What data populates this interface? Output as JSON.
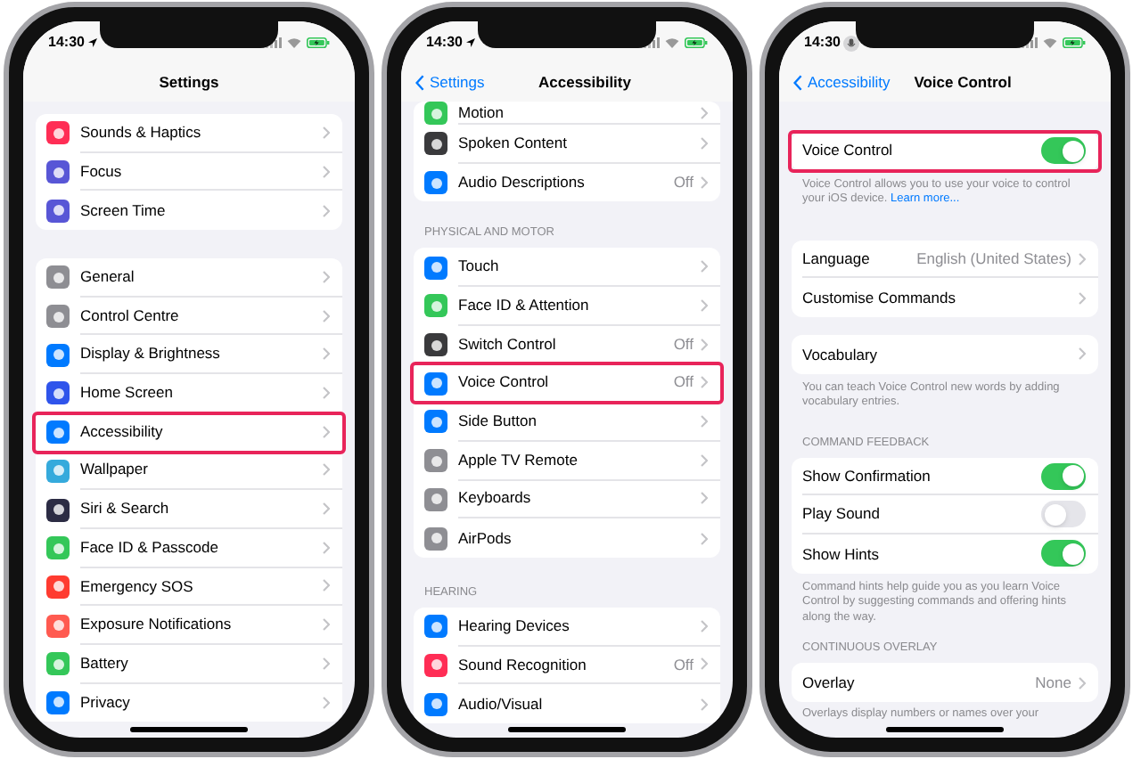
{
  "phones": [
    {
      "time": "14:30",
      "kind": "location",
      "nav": {
        "title": "Settings"
      },
      "sections": [
        {
          "items": [
            {
              "label": "Sounds & Haptics",
              "kind": "link",
              "color": "#ff2d55",
              "highlighted": false
            },
            {
              "label": "Focus",
              "kind": "link",
              "color": "#5856d6",
              "highlighted": false
            },
            {
              "label": "Screen Time",
              "kind": "link",
              "color": "#5856d6",
              "highlighted": false
            }
          ]
        },
        {
          "items": [
            {
              "label": "General",
              "kind": "link",
              "color": "#8e8e93",
              "highlighted": false
            },
            {
              "label": "Control Centre",
              "kind": "link",
              "color": "#8e8e93",
              "highlighted": false
            },
            {
              "label": "Display & Brightness",
              "kind": "link",
              "color": "#007aff",
              "highlighted": false
            },
            {
              "label": "Home Screen",
              "kind": "link",
              "color": "#2f54eb",
              "highlighted": false
            },
            {
              "label": "Accessibility",
              "kind": "link",
              "color": "#007aff",
              "highlighted": true
            },
            {
              "label": "Wallpaper",
              "kind": "link",
              "color": "#35aadc",
              "highlighted": false
            },
            {
              "label": "Siri & Search",
              "kind": "link",
              "color": "#2c2c44",
              "highlighted": false
            },
            {
              "label": "Face ID & Passcode",
              "kind": "link",
              "color": "#34c759",
              "highlighted": false
            },
            {
              "label": "Emergency SOS",
              "kind": "link",
              "color": "#ff3b30",
              "highlighted": false
            },
            {
              "label": "Exposure Notifications",
              "kind": "link",
              "color": "#ff5a50",
              "highlighted": false
            },
            {
              "label": "Battery",
              "kind": "link",
              "color": "#34c759",
              "highlighted": false
            },
            {
              "label": "Privacy",
              "kind": "link",
              "color": "#007aff",
              "highlighted": false
            }
          ]
        }
      ]
    },
    {
      "time": "14:30",
      "kind": "location",
      "nav": {
        "back": "Settings",
        "title": "Accessibility"
      },
      "sections": [
        {
          "items": [
            {
              "label": "Motion",
              "kind": "link",
              "color": "#34c759",
              "highlighted": false
            },
            {
              "label": "Spoken Content",
              "kind": "link",
              "color": "#3a3a3c",
              "highlighted": false
            },
            {
              "label": "Audio Descriptions",
              "value": "Off",
              "kind": "link",
              "color": "#007aff",
              "highlighted": false
            }
          ]
        },
        {
          "header": "PHYSICAL AND MOTOR",
          "items": [
            {
              "label": "Touch",
              "kind": "link",
              "color": "#007aff",
              "highlighted": false
            },
            {
              "label": "Face ID & Attention",
              "kind": "link",
              "color": "#34c759",
              "highlighted": false
            },
            {
              "label": "Switch Control",
              "value": "Off",
              "kind": "link",
              "color": "#3a3a3c",
              "highlighted": false
            },
            {
              "label": "Voice Control",
              "value": "Off",
              "kind": "link",
              "color": "#007aff",
              "highlighted": true
            },
            {
              "label": "Side Button",
              "kind": "link",
              "color": "#007aff",
              "highlighted": false
            },
            {
              "label": "Apple TV Remote",
              "kind": "link",
              "color": "#8e8e93",
              "highlighted": false
            },
            {
              "label": "Keyboards",
              "kind": "link",
              "color": "#8e8e93",
              "highlighted": false
            },
            {
              "label": "AirPods",
              "kind": "link",
              "color": "#8e8e93",
              "highlighted": false
            }
          ]
        },
        {
          "header": "HEARING",
          "items": [
            {
              "label": "Hearing Devices",
              "kind": "link",
              "color": "#007aff",
              "highlighted": false
            },
            {
              "label": "Sound Recognition",
              "value": "Off",
              "kind": "link",
              "color": "#ff2d55",
              "highlighted": false
            },
            {
              "label": "Audio/Visual",
              "kind": "link",
              "color": "#007aff",
              "highlighted": false
            }
          ]
        }
      ]
    },
    {
      "time": "14:30",
      "kind": "mic",
      "nav": {
        "back": "Accessibility",
        "title": "Voice Control"
      },
      "sections": [
        {
          "items": [
            {
              "label": "Voice Control",
              "kind": "toggle",
              "on": true,
              "highlighted": true
            }
          ],
          "footer": "Voice Control allows you to use your voice to control your iOS device.",
          "footer_link": "Learn more..."
        },
        {
          "items": [
            {
              "label": "Language",
              "value": "English (United States)",
              "kind": "link",
              "highlighted": false
            },
            {
              "label": "Customise Commands",
              "kind": "link",
              "highlighted": false
            }
          ]
        },
        {
          "items": [
            {
              "label": "Vocabulary",
              "kind": "link",
              "highlighted": false
            }
          ],
          "footer": "You can teach Voice Control new words by adding vocabulary entries."
        },
        {
          "header": "COMMAND FEEDBACK",
          "items": [
            {
              "label": "Show Confirmation",
              "kind": "toggle",
              "on": true,
              "highlighted": false
            },
            {
              "label": "Play Sound",
              "kind": "toggle",
              "on": false,
              "highlighted": false
            },
            {
              "label": "Show Hints",
              "kind": "toggle",
              "on": true,
              "highlighted": false
            }
          ],
          "footer": "Command hints help guide you as you learn Voice Control by suggesting commands and offering hints along the way."
        },
        {
          "header": "CONTINUOUS OVERLAY",
          "items": [
            {
              "label": "Overlay",
              "value": "None",
              "kind": "link",
              "highlighted": false
            }
          ],
          "footer": "Overlays display numbers or names over your"
        }
      ]
    }
  ]
}
